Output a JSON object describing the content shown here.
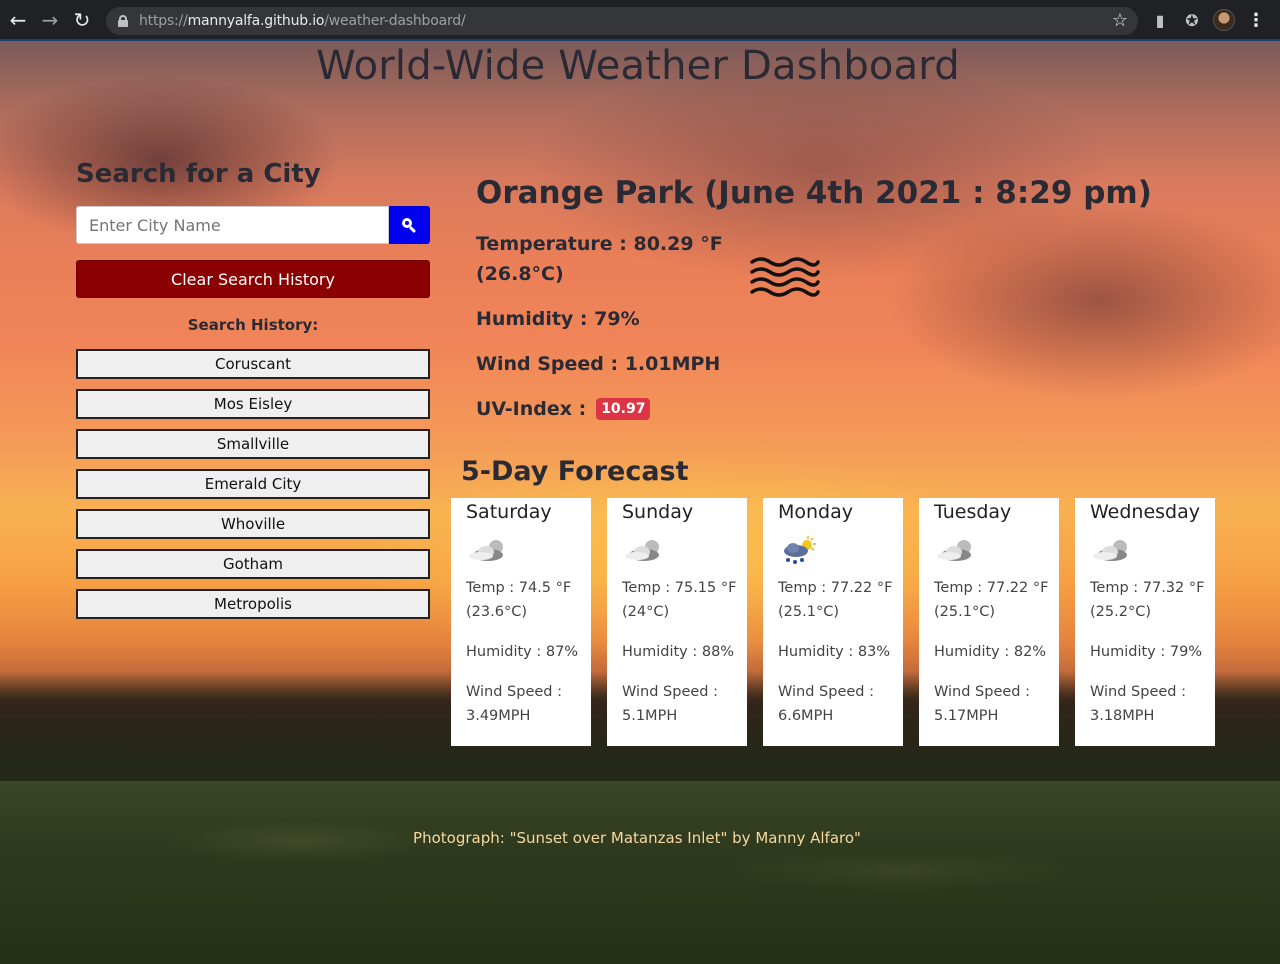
{
  "browser": {
    "url_prefix": "https://",
    "url_host": "mannyalfa.github.io",
    "url_path": "/weather-dashboard/"
  },
  "page": {
    "title": "World-Wide Weather Dashboard",
    "credit": "Photograph: \"Sunset over Matanzas Inlet\" by Manny Alfaro\""
  },
  "search": {
    "heading": "Search for a City",
    "placeholder": "Enter City Name",
    "clear_label": "Clear Search History",
    "history_label": "Search History:",
    "history": [
      "Coruscant",
      "Mos Eisley",
      "Smallville",
      "Emerald City",
      "Whoville",
      "Gotham",
      "Metropolis"
    ]
  },
  "current": {
    "city_title": "Orange Park (June 4th 2021 : 8:29 pm)",
    "temperature": "Temperature : 80.29 °F (26.8°C)",
    "humidity": "Humidity : 79%",
    "wind": "Wind Speed : 1.01MPH",
    "uv_label": "UV-Index :",
    "uv_value": "10.97",
    "uv_color": "#dc3545",
    "icon": "haze-icon"
  },
  "forecast": {
    "heading": "5-Day Forecast",
    "days": [
      {
        "day": "Saturday",
        "icon": "cloudy-night-icon",
        "temp": "Temp : 74.5 °F (23.6°C)",
        "humidity": "Humidity : 87%",
        "wind": "Wind Speed : 3.49MPH"
      },
      {
        "day": "Sunday",
        "icon": "cloudy-night-icon",
        "temp": "Temp : 75.15 °F (24°C)",
        "humidity": "Humidity : 88%",
        "wind": "Wind Speed : 5.1MPH"
      },
      {
        "day": "Monday",
        "icon": "rain-sun-icon",
        "temp": "Temp : 77.22 °F (25.1°C)",
        "humidity": "Humidity : 83%",
        "wind": "Wind Speed : 6.6MPH"
      },
      {
        "day": "Tuesday",
        "icon": "cloudy-night-icon",
        "temp": "Temp : 77.22 °F (25.1°C)",
        "humidity": "Humidity : 82%",
        "wind": "Wind Speed : 5.17MPH"
      },
      {
        "day": "Wednesday",
        "icon": "cloudy-night-icon",
        "temp": "Temp : 77.32 °F (25.2°C)",
        "humidity": "Humidity : 79%",
        "wind": "Wind Speed : 3.18MPH"
      }
    ]
  }
}
